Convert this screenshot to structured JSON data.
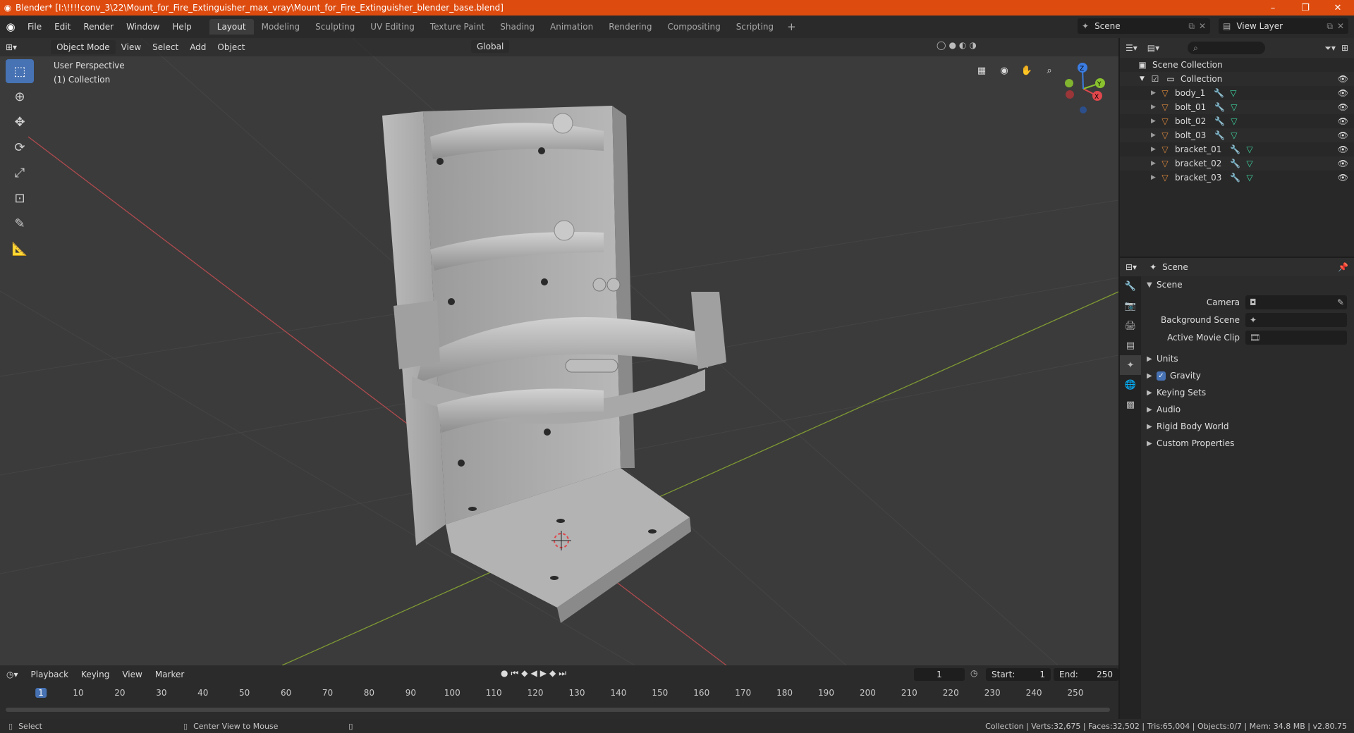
{
  "window": {
    "title": "Blender* [I:\\!!!!conv_3\\22\\Mount_for_Fire_Extinguisher_max_vray\\Mount_for_Fire_Extinguisher_blender_base.blend]",
    "minimize": "–",
    "maximize": "❐",
    "close": "✕"
  },
  "menu": [
    "File",
    "Edit",
    "Render",
    "Window",
    "Help"
  ],
  "workspaces": [
    "Layout",
    "Modeling",
    "Sculpting",
    "UV Editing",
    "Texture Paint",
    "Shading",
    "Animation",
    "Rendering",
    "Compositing",
    "Scripting"
  ],
  "active_workspace": "Layout",
  "scene_selector": "Scene",
  "view_layer_selector": "View Layer",
  "viewport": {
    "mode": "Object Mode",
    "menus": [
      "View",
      "Select",
      "Add",
      "Object"
    ],
    "orientation": "Global",
    "perspective_label": "User Perspective",
    "collection_label": "(1) Collection",
    "gizmo_axes": [
      "X",
      "Y",
      "Z"
    ]
  },
  "timeline": {
    "menus": [
      "Playback",
      "Keying",
      "View",
      "Marker"
    ],
    "current_frame": "1",
    "start_label": "Start:",
    "start": "1",
    "end_label": "End:",
    "end": "250",
    "ticks": [
      "1",
      "10",
      "20",
      "30",
      "40",
      "50",
      "60",
      "70",
      "80",
      "90",
      "100",
      "110",
      "120",
      "130",
      "140",
      "150",
      "160",
      "170",
      "180",
      "190",
      "200",
      "210",
      "220",
      "230",
      "240",
      "250"
    ]
  },
  "outliner": {
    "root": "Scene Collection",
    "collection": "Collection",
    "objects": [
      "body_1",
      "bolt_01",
      "bolt_02",
      "bolt_03",
      "bracket_01",
      "bracket_02",
      "bracket_03"
    ]
  },
  "properties": {
    "context": "Scene",
    "scene_panel": "Scene",
    "rows": [
      {
        "label": "Camera"
      },
      {
        "label": "Background Scene"
      },
      {
        "label": "Active Movie Clip"
      }
    ],
    "panels": [
      "Units",
      "Gravity",
      "Keying Sets",
      "Audio",
      "Rigid Body World",
      "Custom Properties"
    ]
  },
  "statusbar": {
    "left": "Select",
    "middle": "Center View to Mouse",
    "stats": "Collection | Verts:32,675 | Faces:32,502 | Tris:65,004 | Objects:0/7 | Mem: 34.8 MB | v2.80.75"
  },
  "colors": {
    "titlebar": "#de4b0f",
    "accent": "#4772b3",
    "x_axis": "#e0474c",
    "y_axis": "#8ac22f",
    "z_axis": "#3b7de3"
  }
}
